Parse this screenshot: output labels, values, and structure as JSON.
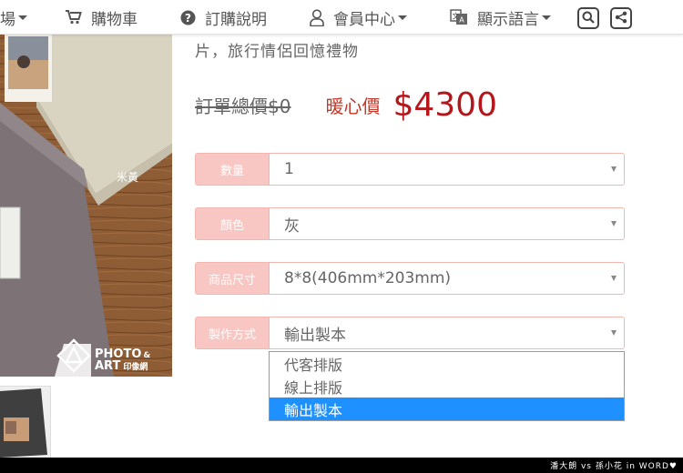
{
  "nav": {
    "partial_item": "場",
    "cart": "購物車",
    "order_info": "訂購說明",
    "member": "會員中心",
    "language": "顯示語言"
  },
  "photo": {
    "color_label": "米黃",
    "logo_text_1": "PHOTO",
    "logo_amp": "&",
    "logo_text_2": "ART",
    "logo_cn": "印像網"
  },
  "product": {
    "subtitle": "片，旅行情侶回憶禮物",
    "original_price": "訂單總價$0",
    "warm_label": "暖心價",
    "price": "$4300"
  },
  "options": [
    {
      "label": "數量",
      "value": "1"
    },
    {
      "label": "顏色",
      "value": "灰"
    },
    {
      "label": "商品尺寸",
      "value": "8*8(406mm*203mm)"
    },
    {
      "label": "製作方式",
      "value": "輸出製本"
    }
  ],
  "dropdown": {
    "items": [
      "代客排版",
      "線上排版",
      "輸出製本"
    ],
    "selected_index": 2
  },
  "footer": {
    "watermark": "潘大朗 vs 孫小花 in WORD♥"
  }
}
